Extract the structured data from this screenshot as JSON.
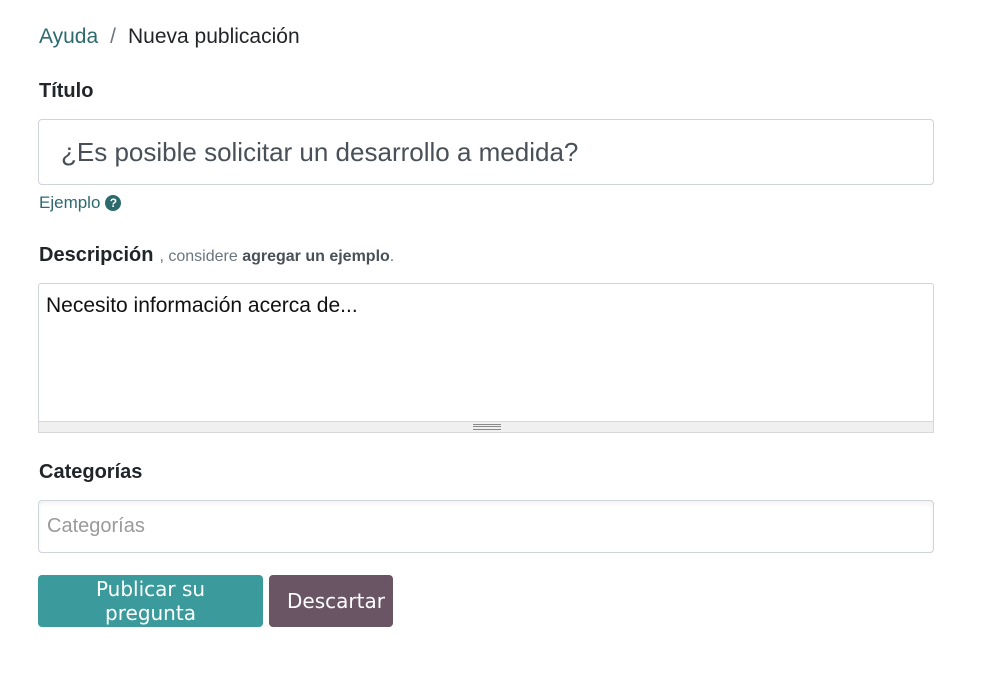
{
  "breadcrumb": {
    "parent": "Ayuda",
    "separator": "/",
    "current": "Nueva publicación"
  },
  "title_field": {
    "label": "Título",
    "value": "¿Es posible solicitar un desarrollo a medida?",
    "example_link": "Ejemplo"
  },
  "description_field": {
    "label": "Descripción",
    "hint_prefix": ", considere",
    "hint_bold": "agregar un ejemplo",
    "hint_suffix": ".",
    "value": "Necesito información acerca de..."
  },
  "categories_field": {
    "label": "Categorías",
    "placeholder": "Categorías"
  },
  "buttons": {
    "submit": "Publicar su pregunta",
    "discard": "Descartar"
  },
  "colors": {
    "link": "#2d6a6e",
    "primary_button": "#3a9a9c",
    "secondary_button": "#6a5565"
  },
  "icons": {
    "example_help": "question-circle-icon",
    "resize": "resize-grip-icon"
  }
}
